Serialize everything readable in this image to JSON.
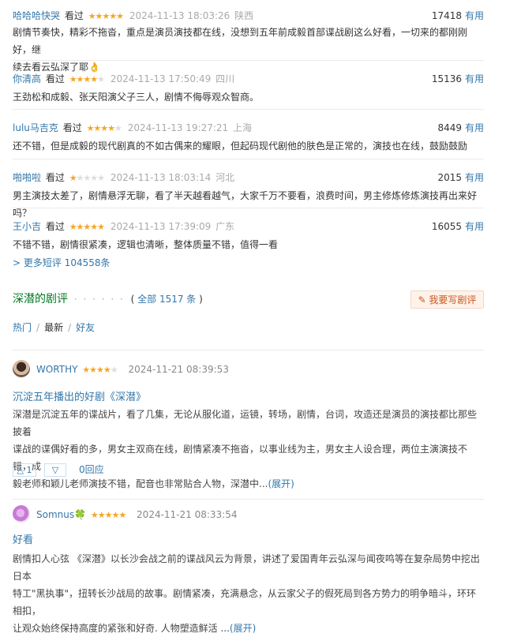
{
  "short_comments": [
    {
      "user": "哈哈哈快哭",
      "watched": "看过",
      "rating": 5,
      "time": "2024-11-13 18:03:26",
      "location": "陕西",
      "votes": "17418",
      "useful": "有用",
      "text": [
        "剧情节奏快，精彩不拖沓，重点是演员演技都在线，没想到五年前成毅首部谍战剧这么好看，一切来的都刚刚好，继",
        "续去看云弘深了耶👌"
      ]
    },
    {
      "user": "你清高",
      "watched": "看过",
      "rating": 4,
      "time": "2024-11-13 17:50:49",
      "location": "四川",
      "votes": "15136",
      "useful": "有用",
      "text": [
        "王劲松和成毅、张天阳演父子三人，剧情不侮辱观众智商。"
      ]
    },
    {
      "user": "lulu马吉克",
      "watched": "看过",
      "rating": 4,
      "time": "2024-11-13 19:27:21",
      "location": "上海",
      "votes": "8449",
      "useful": "有用",
      "text": [
        "还不错，但是成毅的现代剧真的不如古偶来的耀眼，但起码现代剧他的肤色是正常的，演技也在线，鼓励鼓励"
      ]
    },
    {
      "user": "啪啪啦",
      "watched": "看过",
      "rating": 1,
      "time": "2024-11-13 18:03:14",
      "location": "河北",
      "votes": "2015",
      "useful": "有用",
      "text": [
        "男主演技太差了，剧情悬浮无聊，看了半天越看越气，大家千万不要看，浪费时间，男主修炼修炼演技再出来好吗？"
      ]
    },
    {
      "user": "王小吉",
      "watched": "看过",
      "rating": 5,
      "time": "2024-11-13 17:39:09",
      "location": "广东",
      "votes": "16055",
      "useful": "有用",
      "text": [
        "不错不错，剧情很紧凑，逻辑也清晰，整体质量不错，值得一看"
      ]
    }
  ],
  "more_short": "> 更多短评 104558条",
  "reviews_header": {
    "title": "深潜的剧评",
    "dots": "· · · · · ·",
    "paren_open": "(",
    "count": "全部 1517 条",
    "paren_close": ")",
    "write": "✎ 我要写剧评"
  },
  "tabs": [
    "热门",
    "最新",
    "好友"
  ],
  "reviews": [
    {
      "user": "WORTHY",
      "rating": 4,
      "date": "2024-11-21 08:39:53",
      "title": "沉淀五年播出的好剧《深潜》",
      "body": [
        "深潜是沉淀五年的谍战片，看了几集，无论从服化道，运镜，转场，剧情，台词，攻造还是演员的演技都比那些披着",
        "谍战的谍偶好看的多，男女主双商在线，剧情紧凑不拖沓，以事业线为主，男女主人设合理，两位主演演技不错，成",
        "毅老师和颖儿老师演技不错，配音也非常贴合人物，深潜中..."
      ],
      "expand": "(展开)",
      "up": "△ 1",
      "down": "▽",
      "reply": "0回应"
    },
    {
      "user": "Somnus",
      "badge": "🍀",
      "rating": 5,
      "date": "2024-11-21 08:33:54",
      "title": "好看",
      "body": [
        "剧情扣人心弦 《深潜》以长沙会战之前的谍战风云为背景，讲述了爱国青年云弘深与闻夜鸣等在复杂局势中挖出日本",
        "特工\"黑执事\"，扭转长沙战局的故事。剧情紧凑，充满悬念，从云家父子的假死局到各方势力的明争暗斗，环环相扣，",
        "让观众始终保持高度的紧张和好奇. 人物塑造鲜活 ..."
      ],
      "expand": "(展开)"
    }
  ],
  "colors": {
    "link": "#3377aa",
    "green": "#007722",
    "star": "#f5a623",
    "write_bg": "#fff2e9",
    "write_text": "#c8581e"
  }
}
